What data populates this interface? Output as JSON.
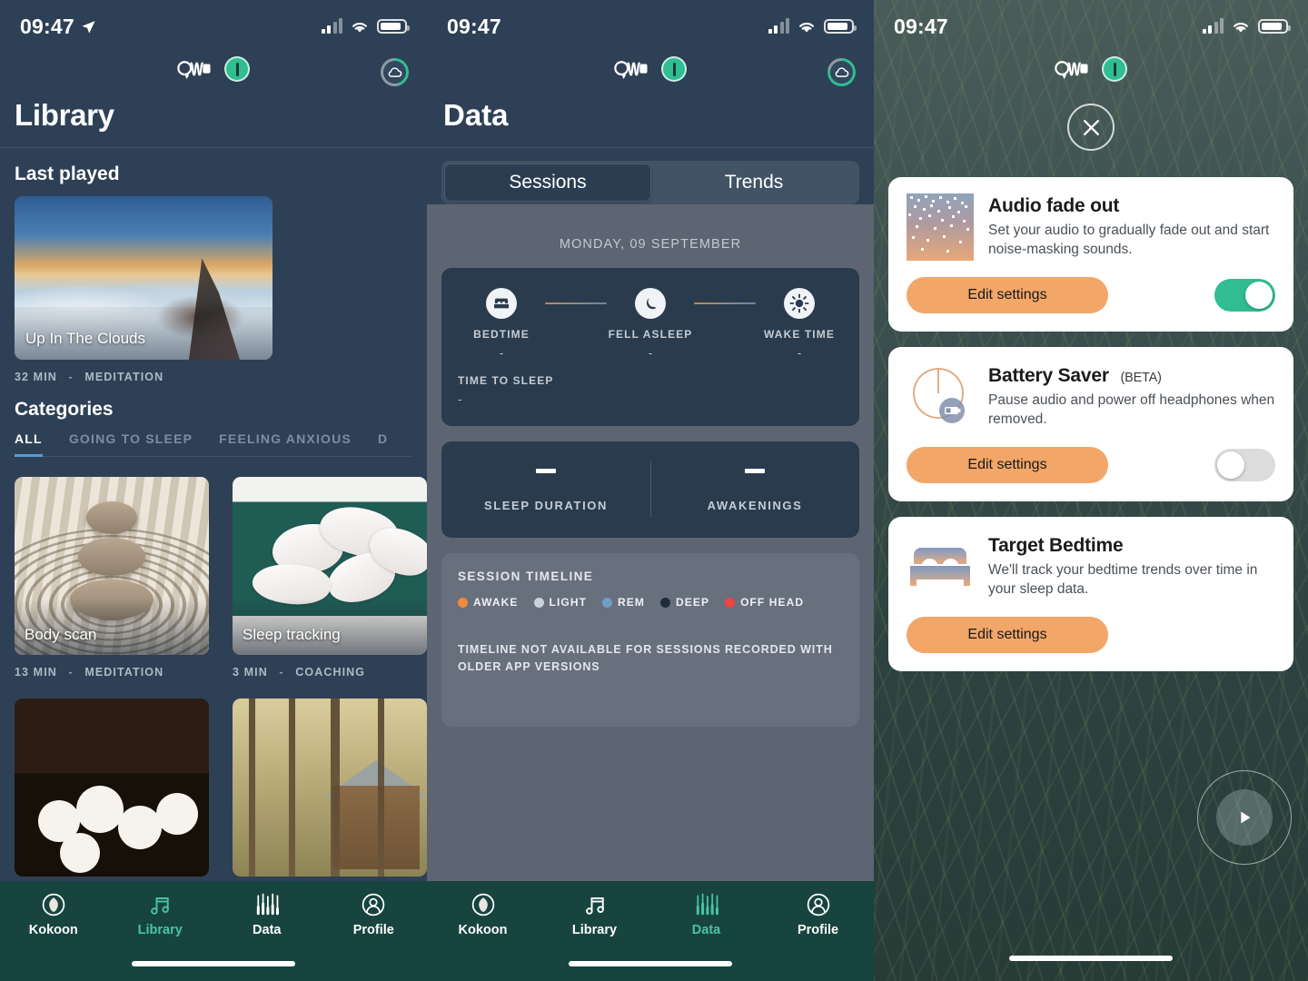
{
  "status_bar": {
    "time": "09:47",
    "location_icon": "location-arrow-icon",
    "cellular_icon": "cellular-signal-icon",
    "wifi_icon": "wifi-icon",
    "battery_icon": "battery-icon"
  },
  "device_bar": {
    "headphone_icon": "headphones-icon",
    "alert_icon": "alert-badge-icon",
    "cloud_icon": "cloud-sync-icon"
  },
  "library": {
    "title": "Library",
    "last_played_heading": "Last played",
    "hero": {
      "title": "Up In The Clouds",
      "duration": "32 MIN",
      "separator": "-",
      "category": "MEDITATION"
    },
    "categories_heading": "Categories",
    "category_tabs": [
      {
        "label": "ALL",
        "active": true
      },
      {
        "label": "GOING TO SLEEP",
        "active": false
      },
      {
        "label": "FEELING ANXIOUS",
        "active": false
      },
      {
        "label": "D",
        "active": false
      }
    ],
    "tiles": [
      {
        "title": "Body scan",
        "duration": "13 MIN",
        "separator": "-",
        "category": "MEDITATION"
      },
      {
        "title": "Sleep tracking",
        "duration": "3 MIN",
        "separator": "-",
        "category": "COACHING"
      }
    ]
  },
  "data_screen": {
    "title": "Data",
    "segments": [
      {
        "label": "Sessions",
        "selected": true
      },
      {
        "label": "Trends",
        "selected": false
      }
    ],
    "date_header": "MONDAY, 09 SEPTEMBER",
    "sleep_stages": [
      {
        "icon": "bed-icon",
        "label": "BEDTIME",
        "value": "-"
      },
      {
        "icon": "moon-icon",
        "label": "FELL ASLEEP",
        "value": "-"
      },
      {
        "icon": "sun-icon",
        "label": "WAKE TIME",
        "value": "-"
      }
    ],
    "time_to_sleep": {
      "label": "TIME TO SLEEP",
      "value": "-"
    },
    "stats": [
      {
        "value": "–",
        "label": "SLEEP DURATION"
      },
      {
        "value": "–",
        "label": "AWAKENINGS"
      }
    ],
    "timeline": {
      "title": "SESSION TIMELINE",
      "legend": [
        {
          "label": "AWAKE",
          "color": "#ef8b3c"
        },
        {
          "label": "LIGHT",
          "color": "#c9d3dd"
        },
        {
          "label": "REM",
          "color": "#6f9fc6"
        },
        {
          "label": "DEEP",
          "color": "#1d2b3a"
        },
        {
          "label": "OFF HEAD",
          "color": "#f0453f"
        }
      ],
      "note": "TIMELINE NOT AVAILABLE FOR SESSIONS RECORDED WITH OLDER APP VERSIONS"
    }
  },
  "wizard": {
    "close_icon": "close-icon",
    "play_icon": "play-icon",
    "cards": [
      {
        "thumb_icon": "audio-fade-icon",
        "title": "Audio fade out",
        "badge": "",
        "description": "Set your audio to gradually fade out and start noise-masking sounds.",
        "button_label": "Edit settings",
        "toggle_on": true
      },
      {
        "thumb_icon": "battery-saver-icon",
        "title": "Battery Saver",
        "badge": "(BETA)",
        "description": "Pause audio and power off headphones when removed.",
        "button_label": "Edit settings",
        "toggle_on": false
      },
      {
        "thumb_icon": "bed-icon",
        "title": "Target Bedtime",
        "badge": "",
        "description": "We'll track your bedtime trends over time in your sleep data.",
        "button_label": "Edit settings",
        "toggle_on": null
      }
    ]
  },
  "bottom_nav": [
    {
      "icon": "kokoon-logo-icon",
      "label": "Kokoon",
      "active_lib": false,
      "active_data": false
    },
    {
      "icon": "music-note-icon",
      "label": "Library",
      "active_lib": true,
      "active_data": false
    },
    {
      "icon": "bars-chart-icon",
      "label": "Data",
      "active_lib": false,
      "active_data": true
    },
    {
      "icon": "person-icon",
      "label": "Profile",
      "active_lib": false,
      "active_data": false
    }
  ],
  "colors": {
    "accent_green": "#2fbd91",
    "accent_orange": "#f2a668",
    "nav_bg": "#17443e",
    "panel1_bg": "#2e4055",
    "panel2_bg": "#5d6472",
    "tab_underline": "#5b9bd5"
  }
}
